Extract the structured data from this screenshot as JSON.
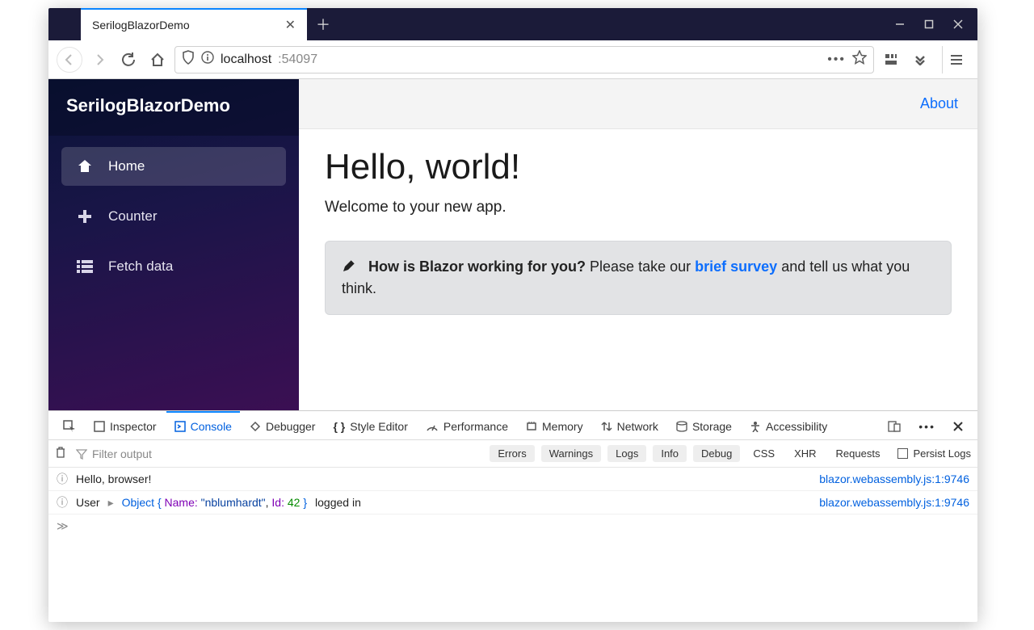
{
  "browser": {
    "tab_title": "SerilogBlazorDemo",
    "url_host": "localhost",
    "url_port": ":54097"
  },
  "sidebar": {
    "brand": "SerilogBlazorDemo",
    "items": [
      {
        "label": "Home"
      },
      {
        "label": "Counter"
      },
      {
        "label": "Fetch data"
      }
    ]
  },
  "topbar": {
    "about": "About"
  },
  "page": {
    "heading": "Hello, world!",
    "lead": "Welcome to your new app.",
    "alert_strong": "How is Blazor working for you?",
    "alert_before_link": " Please take our ",
    "alert_link": "brief survey",
    "alert_after_link": " and tell us what you think."
  },
  "devtools": {
    "tabs": {
      "inspector": "Inspector",
      "console": "Console",
      "debugger": "Debugger",
      "style": "Style Editor",
      "perf": "Performance",
      "memory": "Memory",
      "network": "Network",
      "storage": "Storage",
      "a11y": "Accessibility"
    },
    "filter_placeholder": "Filter output",
    "levels": {
      "errors": "Errors",
      "warnings": "Warnings",
      "logs": "Logs",
      "info": "Info",
      "debug": "Debug"
    },
    "extra": {
      "css": "CSS",
      "xhr": "XHR",
      "requests": "Requests",
      "persist": "Persist Logs"
    },
    "log1": {
      "msg": "Hello, browser!",
      "src": "blazor.webassembly.js:1:9746"
    },
    "log2": {
      "prefix": "User",
      "obj_open": "Object {",
      "k_name": " Name:",
      "v_name": " \"nblumhardt\"",
      "sep": ",",
      "k_id": " Id:",
      "v_id": " 42",
      "obj_close": " }",
      "suffix": "  logged in",
      "src": "blazor.webassembly.js:1:9746"
    }
  }
}
